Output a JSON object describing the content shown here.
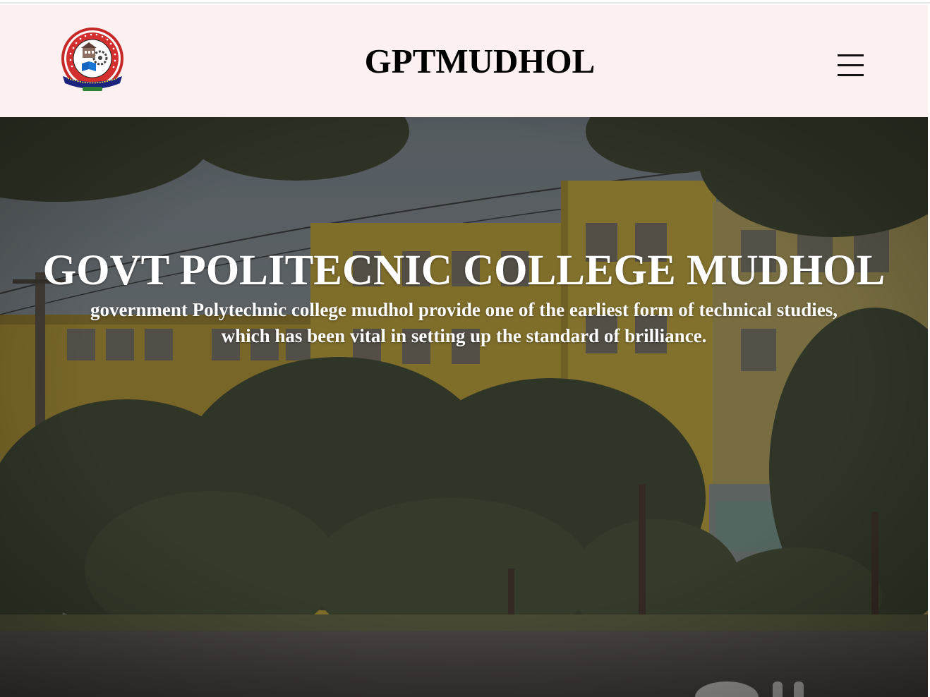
{
  "header": {
    "logo_icon": "college-emblem-icon",
    "logo_ring_text": "GOVERNMENT POLYTECHNIC MUDHOL",
    "logo_motto": "Education is Our Passport to the Future",
    "logo_est": "Estd : 2000",
    "title": "GPTMUDHOL",
    "menu_icon": "hamburger-menu-icon",
    "background": "#fdf0f0"
  },
  "hero": {
    "title": "GOVT POLITECNIC COLLEGE MUDHOL",
    "subtitle_line1": "government Polytechnic college mudhol provide one of the earliest form of technical studies,",
    "subtitle_line2": "which has been vital in setting up the standard of brilliance.",
    "text_color": "#ffffff"
  }
}
